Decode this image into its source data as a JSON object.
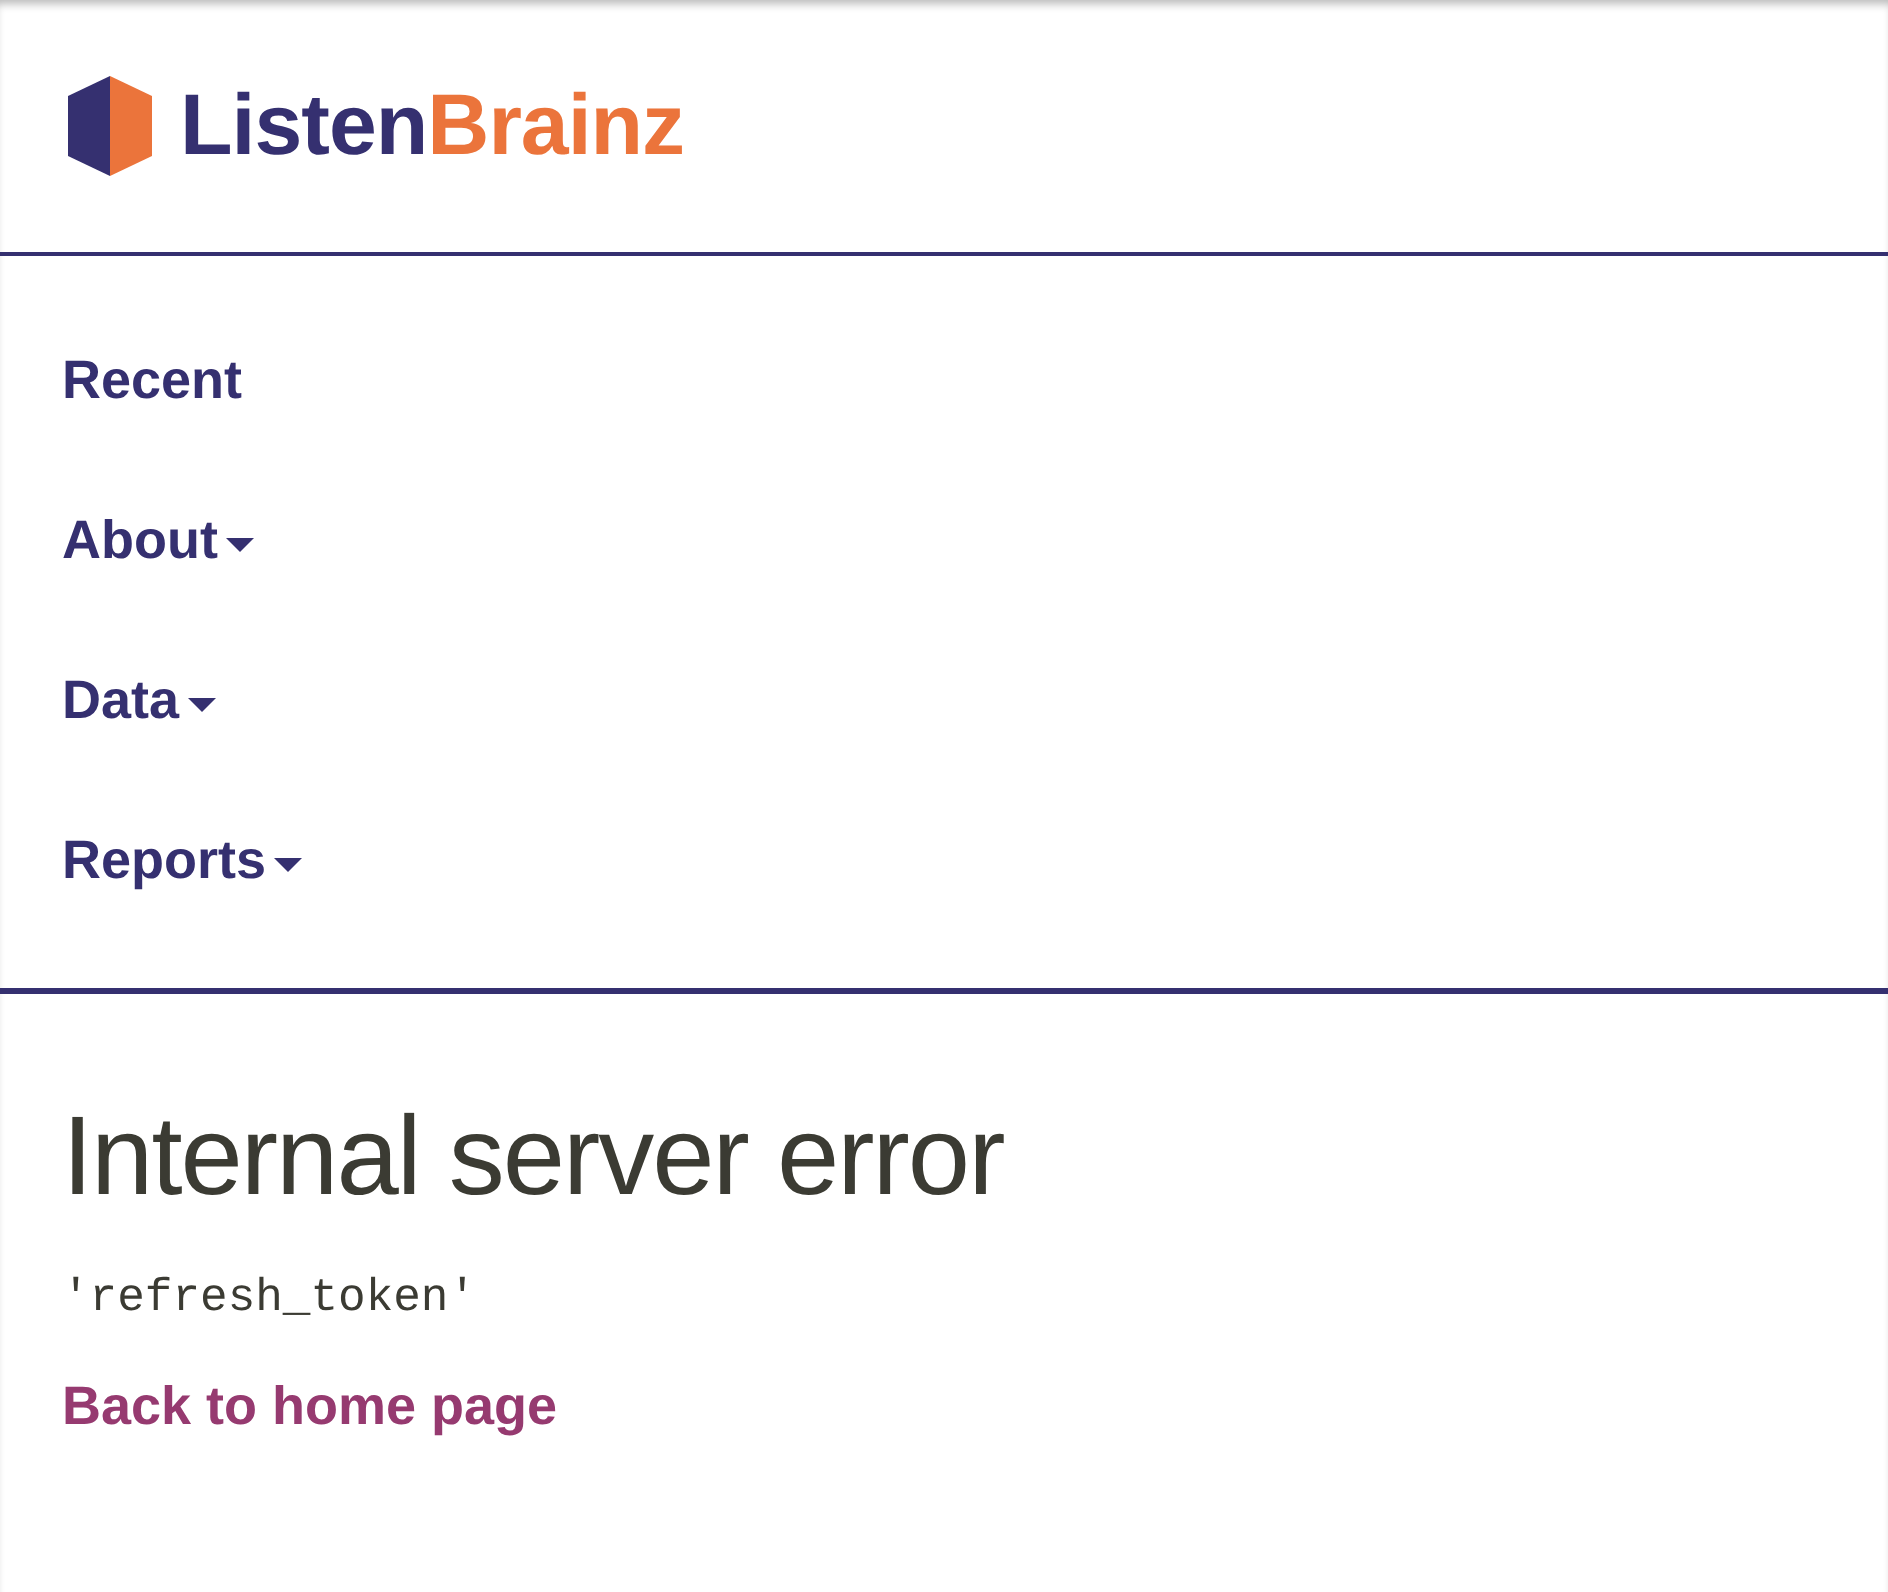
{
  "logo": {
    "parts": [
      {
        "text": "Listen",
        "color": "#353070"
      },
      {
        "text": "Brainz",
        "color": "#eb743b"
      }
    ]
  },
  "nav": {
    "items": [
      {
        "label": "Recent",
        "has_dropdown": false
      },
      {
        "label": "About",
        "has_dropdown": true
      },
      {
        "label": "Data",
        "has_dropdown": true
      },
      {
        "label": "Reports",
        "has_dropdown": true
      }
    ]
  },
  "error": {
    "title": "Internal server error",
    "message": "'refresh_token'",
    "link": "Back to home page"
  }
}
